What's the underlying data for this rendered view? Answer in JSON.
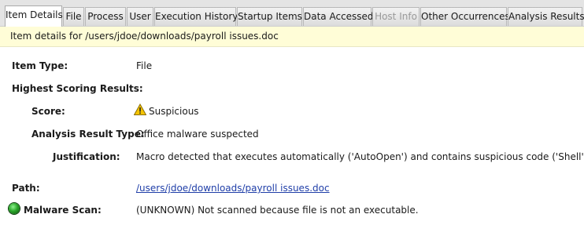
{
  "tabs": [
    {
      "label": "Item Details",
      "state": "active"
    },
    {
      "label": "File",
      "state": "normal"
    },
    {
      "label": "Process",
      "state": "normal"
    },
    {
      "label": "User",
      "state": "normal"
    },
    {
      "label": "Execution History",
      "state": "normal"
    },
    {
      "label": "Startup Items",
      "state": "normal"
    },
    {
      "label": "Data Accessed",
      "state": "normal"
    },
    {
      "label": "Host Info",
      "state": "disabled"
    },
    {
      "label": "Other Occurrences",
      "state": "normal"
    },
    {
      "label": "Analysis Results",
      "state": "normal"
    }
  ],
  "banner": {
    "text": "Item details for /users/jdoe/downloads/payroll issues.doc"
  },
  "details": {
    "item_type_label": "Item Type:",
    "item_type_value": "File",
    "highest_label": "Highest Scoring Results:",
    "score_label": "Score:",
    "score_value": "Suspicious",
    "score_icon": "warning-icon",
    "art_label": "Analysis Result Type:",
    "art_value": "Office malware suspected",
    "just_label": "Justification:",
    "just_value": "Macro detected that executes automatically ('AutoOpen') and contains suspicious code ('Shell')",
    "path_label": "Path:",
    "path_value": "/users/jdoe/downloads/payroll issues.doc",
    "scan_label": "Malware Scan:",
    "scan_value": "(UNKNOWN) Not scanned because file is not an executable.",
    "scan_icon": "status-green-icon"
  },
  "colors": {
    "banner_bg": "#fffdd7",
    "link": "#1f3ea8",
    "warning": "#f5c400",
    "status_green": "#2aa52a"
  }
}
